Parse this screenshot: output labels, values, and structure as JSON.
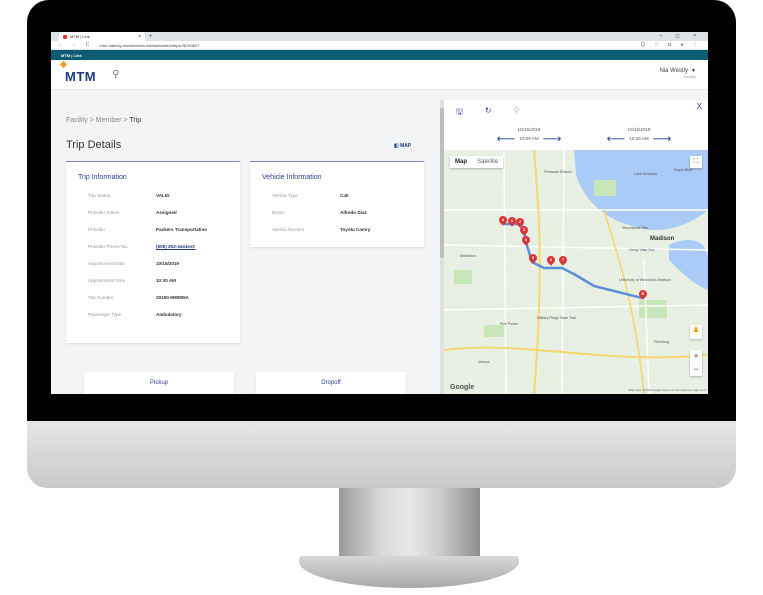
{
  "browser": {
    "tab_title": "MTM | Link",
    "tab_close": "×",
    "new_tab": "+",
    "window_controls": "– ◻ ×",
    "nav": "← → C",
    "url": "mtm-training.nrxsatervicw.net/www/site/#/trips/26763827",
    "extensions": "Q ☆ ◘ ● ⋮"
  },
  "app": {
    "strip_label": "MTM | Link",
    "logo_text": "MTM",
    "user_name": "Nia Westly",
    "user_role": "Facility"
  },
  "breadcrumb": {
    "items": [
      "Facility",
      "Member",
      "Trip"
    ],
    "separator": ">"
  },
  "page_title": "Trip Details",
  "map_link": "MAP",
  "trip_info": {
    "title": "Trip Information",
    "rows": [
      {
        "label": "Trip Status",
        "value": "VALID"
      },
      {
        "label": "Provider Status",
        "value": "Assigned"
      },
      {
        "label": "Provider",
        "value": "Packers Transportation"
      },
      {
        "label": "Provider Phone No.",
        "value": "(608) 253-4444ext:"
      },
      {
        "label": "Appointment Date",
        "value": "10/15/2019"
      },
      {
        "label": "Appointment Time",
        "value": "10:30 AM"
      },
      {
        "label": "Trip Number",
        "value": "20190-9M0M5A"
      },
      {
        "label": "Passenger Type",
        "value": "Ambulatory"
      }
    ]
  },
  "vehicle_info": {
    "title": "Vehicle Information",
    "rows": [
      {
        "label": "Vehicle Type",
        "value": "Cab"
      },
      {
        "label": "Driver",
        "value": "Alfredo Diaz"
      },
      {
        "label": "Vehicle Number",
        "value": "Toyota Camry"
      }
    ]
  },
  "pickup_label": "Pickup",
  "dropoff_label": "Dropoff",
  "map_panel": {
    "close": "X",
    "start": {
      "date": "10/15/2019",
      "time": "10:09 AM"
    },
    "end": {
      "date": "10/15/2019",
      "time": "10:26 AM"
    },
    "map_type_map": "Map",
    "map_type_satellite": "Satellite",
    "google": "Google",
    "footer": "Map data ©2019 Google   Terms of Use   Report a map error",
    "zoom_in": "+",
    "zoom_out": "−",
    "labels": {
      "madison": "Madison",
      "middleton": "Middleton",
      "maple_bluff": "Maple Bluff",
      "shorewood": "Shorewood Hills",
      "university": "University of Wisconsin-Madison",
      "fitchburg": "Fitchburg",
      "fish_hatchery": "Henry Vilas Zoo",
      "verona": "Verona",
      "five_points": "Five Points",
      "military": "Military Ridge State Trail",
      "pheasant": "Pheasant Branch",
      "lake": "Lake Mendota"
    },
    "markers": [
      "A",
      "1",
      "2",
      "3",
      "4",
      "5",
      "6",
      "7",
      "B"
    ]
  }
}
